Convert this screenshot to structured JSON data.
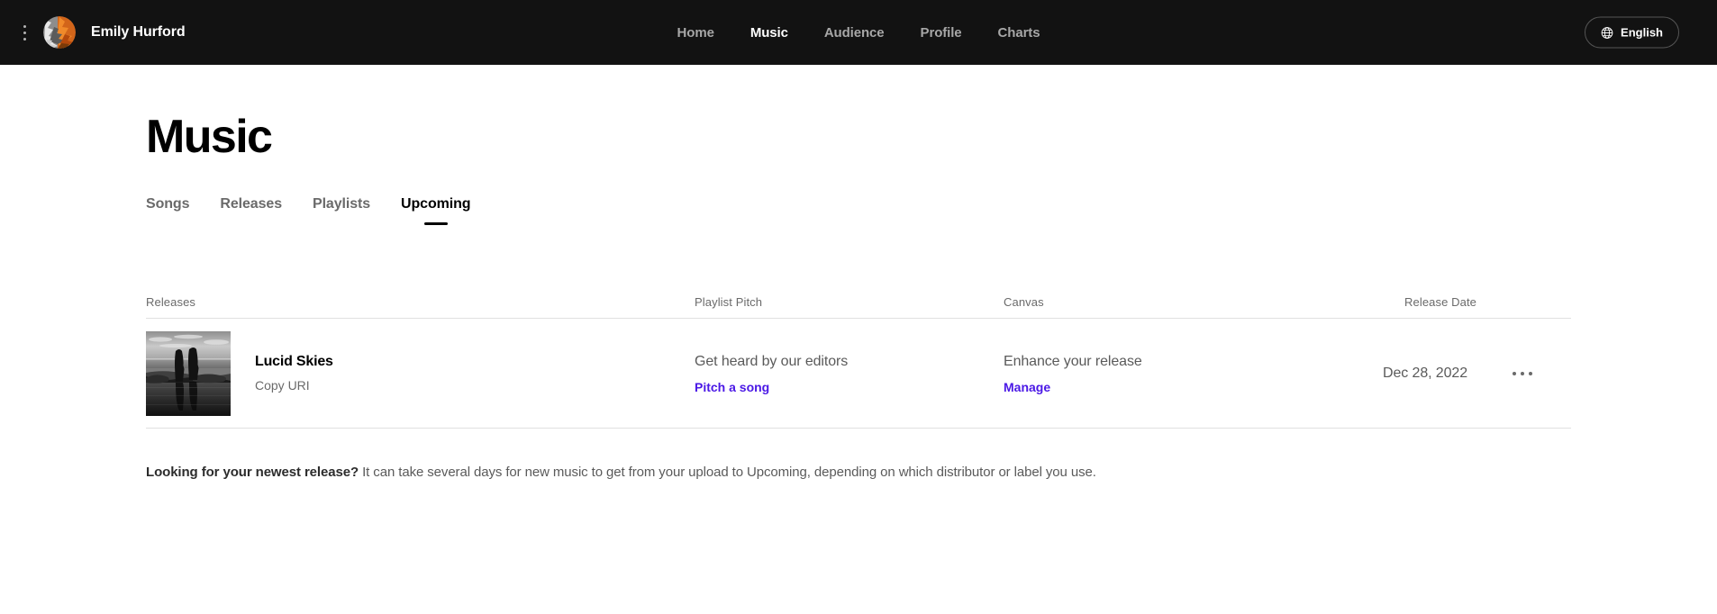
{
  "topbar": {
    "menu_icon": "kebab-vertical-icon",
    "avatar_alt": "artist-avatar",
    "artist_name": "Emily Hurford",
    "nav": [
      {
        "label": "Home",
        "active": false
      },
      {
        "label": "Music",
        "active": true
      },
      {
        "label": "Audience",
        "active": false
      },
      {
        "label": "Profile",
        "active": false
      },
      {
        "label": "Charts",
        "active": false
      }
    ],
    "language": {
      "label": "English",
      "icon": "globe-icon"
    },
    "background": "#121212"
  },
  "page": {
    "title": "Music",
    "tabs": [
      {
        "label": "Songs",
        "active": false
      },
      {
        "label": "Releases",
        "active": false
      },
      {
        "label": "Playlists",
        "active": false
      },
      {
        "label": "Upcoming",
        "active": true
      }
    ]
  },
  "table": {
    "headers": {
      "releases": "Releases",
      "playlist_pitch": "Playlist Pitch",
      "canvas": "Canvas",
      "release_date": "Release Date"
    },
    "rows": [
      {
        "cover_alt": "album-cover-lucid-skies",
        "title": "Lucid Skies",
        "copy_uri": "Copy URI",
        "pitch_label": "Get heard by our editors",
        "pitch_link": "Pitch a song",
        "canvas_label": "Enhance your release",
        "canvas_link": "Manage",
        "release_date": "Dec 28, 2022",
        "overflow_icon": "kebab-horizontal-icon"
      }
    ]
  },
  "footnote": {
    "bold": "Looking for your newest release?",
    "rest": " It can take several days for new music to get from your upload to Upcoming, depending on which distributor or label you use."
  },
  "colors": {
    "link": "#4b19e6",
    "header_bg": "#121212",
    "text_primary": "#000000",
    "text_muted": "#6a6a6a",
    "divider": "#e0e0e0"
  }
}
